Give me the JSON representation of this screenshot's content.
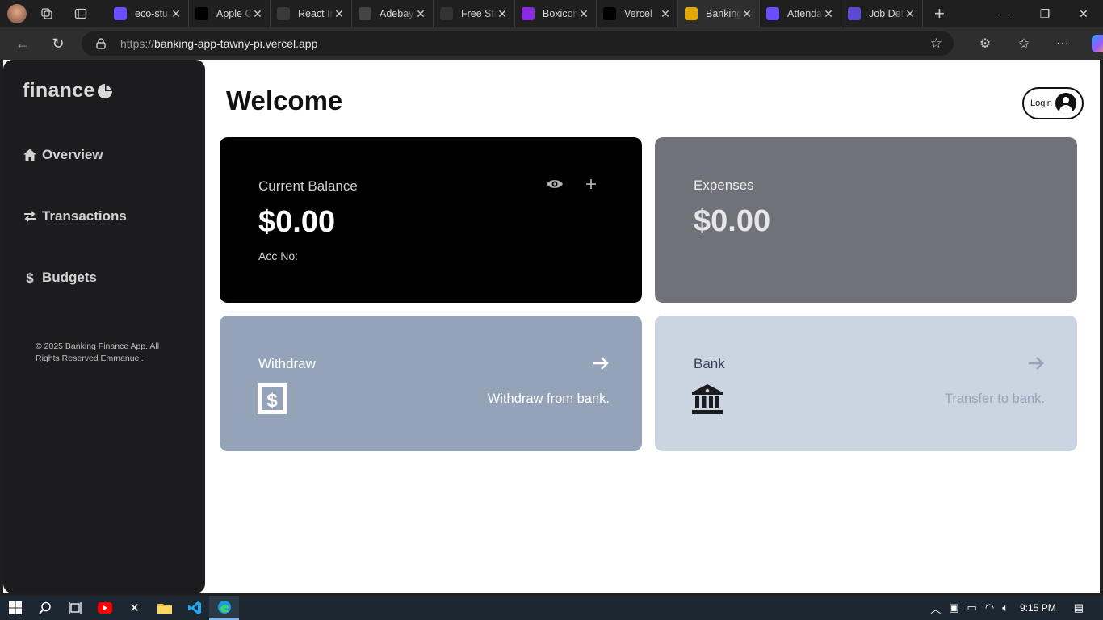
{
  "browser": {
    "tabs": [
      {
        "title": "eco-stu",
        "fav_color": "#6b4cff",
        "fav_icon": "vite-icon"
      },
      {
        "title": "Apple C",
        "fav_color": "#000000",
        "fav_icon": "cursor-icon"
      },
      {
        "title": "React In",
        "fav_color": "#3a3a3a",
        "fav_icon": "react-icon"
      },
      {
        "title": "Adebay",
        "fav_color": "#444444",
        "fav_icon": "github-icon"
      },
      {
        "title": "Free Sto",
        "fav_color": "#333333",
        "fav_icon": "link-icon"
      },
      {
        "title": "Boxicon",
        "fav_color": "#8a2be2",
        "fav_icon": "boxicons-icon"
      },
      {
        "title": "Vercel",
        "fav_color": "#000000",
        "fav_icon": "vercel-icon"
      },
      {
        "title": "Banking",
        "fav_color": "#e0a800",
        "fav_icon": "banking-icon"
      },
      {
        "title": "Attenda",
        "fav_color": "#6b4cff",
        "fav_icon": "vite-icon"
      },
      {
        "title": "Job Det",
        "fav_color": "#5b4ccf",
        "fav_icon": "app-icon"
      }
    ],
    "active_tab": 7,
    "url_prefix": "https://",
    "url_host": "banking-app-tawny-pi.vercel.app"
  },
  "sidebar": {
    "logo_text": "finance",
    "nav": [
      {
        "label": "Overview",
        "icon": "home-icon"
      },
      {
        "label": "Transactions",
        "icon": "swap-icon"
      },
      {
        "label": "Budgets",
        "icon": "dollar-icon"
      }
    ],
    "copyright": "© 2025 Banking Finance App. All Rights Reserved Emmanuel."
  },
  "header": {
    "title": "Welcome",
    "login_label": "Login"
  },
  "cards": {
    "balance": {
      "label": "Current Balance",
      "amount": "$0.00",
      "acc_label": "Acc No:"
    },
    "expenses": {
      "label": "Expenses",
      "amount": "$0.00"
    },
    "withdraw": {
      "label": "Withdraw",
      "sub": "Withdraw from bank."
    },
    "bank": {
      "label": "Bank",
      "sub": "Transfer to bank."
    }
  },
  "colors": {
    "sidebar_bg": "#1c1c1e",
    "balance_bg": "#000000",
    "expenses_bg": "#71717a",
    "withdraw_bg": "#94a3b8",
    "bank_bg": "#cbd5e1"
  },
  "taskbar": {
    "time": "9:15 PM"
  }
}
